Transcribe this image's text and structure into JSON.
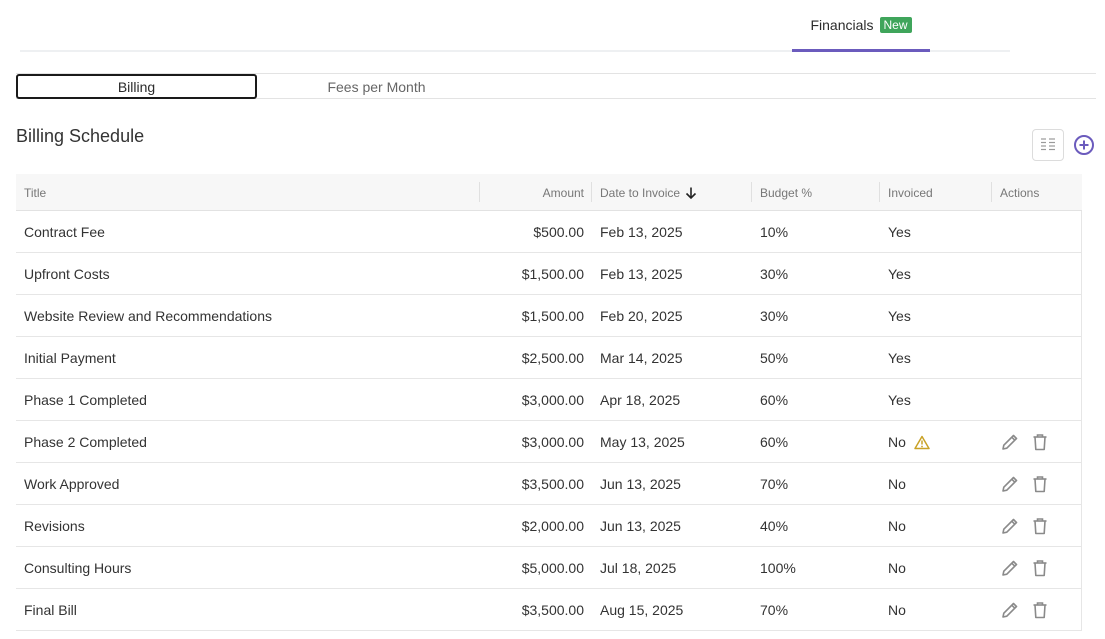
{
  "top_tabs": [
    {
      "label": "Financials",
      "badge": "New",
      "active": true
    }
  ],
  "sub_tabs": [
    {
      "label": "Billing",
      "active": true
    },
    {
      "label": "Fees per Month",
      "active": false
    }
  ],
  "section": {
    "title": "Billing Schedule",
    "columns_icon": "columns-icon",
    "add_icon": "plus-circle-icon"
  },
  "table": {
    "columns": {
      "title": "Title",
      "amount": "Amount",
      "date": "Date to Invoice",
      "budget": "Budget %",
      "invoiced": "Invoiced",
      "actions": "Actions"
    },
    "sort_icon": "arrow-down-icon",
    "rows": [
      {
        "title": "Contract Fee",
        "amount": "$500.00",
        "date": "Feb 13, 2025",
        "budget": "10%",
        "invoiced": "Yes",
        "warning": false,
        "actions": false
      },
      {
        "title": "Upfront Costs",
        "amount": "$1,500.00",
        "date": "Feb 13, 2025",
        "budget": "30%",
        "invoiced": "Yes",
        "warning": false,
        "actions": false
      },
      {
        "title": "Website Review and Recommendations",
        "amount": "$1,500.00",
        "date": "Feb 20, 2025",
        "budget": "30%",
        "invoiced": "Yes",
        "warning": false,
        "actions": false
      },
      {
        "title": "Initial Payment",
        "amount": "$2,500.00",
        "date": "Mar 14, 2025",
        "budget": "50%",
        "invoiced": "Yes",
        "warning": false,
        "actions": false
      },
      {
        "title": "Phase 1 Completed",
        "amount": "$3,000.00",
        "date": "Apr 18, 2025",
        "budget": "60%",
        "invoiced": "Yes",
        "warning": false,
        "actions": false
      },
      {
        "title": "Phase 2 Completed",
        "amount": "$3,000.00",
        "date": "May 13, 2025",
        "budget": "60%",
        "invoiced": "No",
        "warning": true,
        "actions": true
      },
      {
        "title": "Work Approved",
        "amount": "$3,500.00",
        "date": "Jun 13, 2025",
        "budget": "70%",
        "invoiced": "No",
        "warning": false,
        "actions": true
      },
      {
        "title": "Revisions",
        "amount": "$2,000.00",
        "date": "Jun 13, 2025",
        "budget": "40%",
        "invoiced": "No",
        "warning": false,
        "actions": true
      },
      {
        "title": "Consulting Hours",
        "amount": "$5,000.00",
        "date": "Jul 18, 2025",
        "budget": "100%",
        "invoiced": "No",
        "warning": false,
        "actions": true
      },
      {
        "title": "Final Bill",
        "amount": "$3,500.00",
        "date": "Aug 15, 2025",
        "budget": "70%",
        "invoiced": "No",
        "warning": false,
        "actions": true
      }
    ]
  },
  "colors": {
    "accent": "#6b5bbd",
    "badge_green": "#3fa55b",
    "warning": "#c9a227",
    "icon_gray": "#8a8a8a"
  }
}
